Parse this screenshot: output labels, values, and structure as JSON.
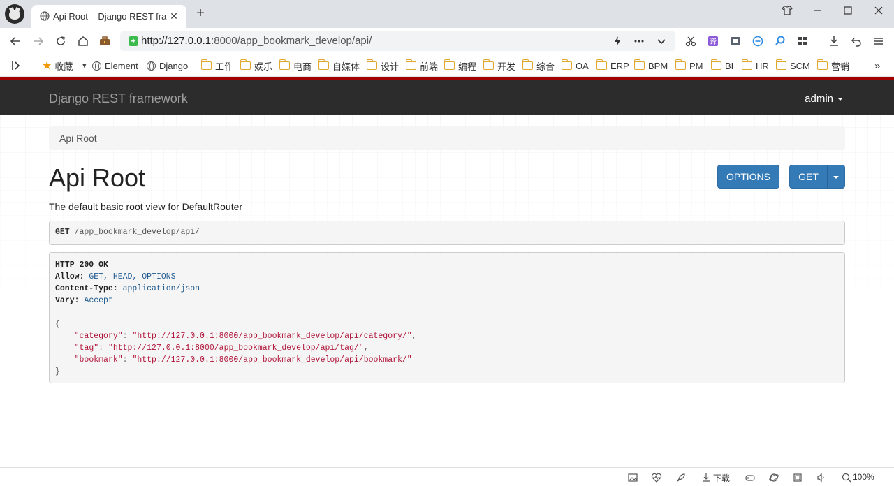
{
  "browser": {
    "tab_title": "Api Root – Django REST fra",
    "url_host": "http://127.0.0.1",
    "url_rest": ":8000/app_bookmark_develop/api/",
    "close_glyph": "✕",
    "newtab_glyph": "+",
    "zoom": "100%",
    "download_label": "下载",
    "bookmarks": [
      {
        "label": "收藏",
        "type": "star"
      },
      {
        "label": "Element",
        "type": "globe"
      },
      {
        "label": "Django",
        "type": "globe"
      },
      {
        "label": "工作",
        "type": "folder"
      },
      {
        "label": "娱乐",
        "type": "folder"
      },
      {
        "label": "电商",
        "type": "folder"
      },
      {
        "label": "自媒体",
        "type": "folder"
      },
      {
        "label": "设计",
        "type": "folder"
      },
      {
        "label": "前端",
        "type": "folder"
      },
      {
        "label": "编程",
        "type": "folder"
      },
      {
        "label": "开发",
        "type": "folder"
      },
      {
        "label": "综合",
        "type": "folder"
      },
      {
        "label": "OA",
        "type": "folder"
      },
      {
        "label": "ERP",
        "type": "folder"
      },
      {
        "label": "BPM",
        "type": "folder"
      },
      {
        "label": "PM",
        "type": "folder"
      },
      {
        "label": "BI",
        "type": "folder"
      },
      {
        "label": "HR",
        "type": "folder"
      },
      {
        "label": "SCM",
        "type": "folder"
      },
      {
        "label": "营销",
        "type": "folder"
      }
    ]
  },
  "app": {
    "brand": "Django REST framework",
    "user": "admin",
    "breadcrumb": "Api Root",
    "title": "Api Root",
    "options_label": "OPTIONS",
    "get_label": "GET",
    "description": "The default basic root view for DefaultRouter",
    "request_method": "GET",
    "request_path": "/app_bookmark_develop/api/",
    "response": {
      "status": "HTTP 200 OK",
      "headers": [
        {
          "key": "Allow:",
          "value": "GET, HEAD, OPTIONS"
        },
        {
          "key": "Content-Type:",
          "value": "application/json"
        },
        {
          "key": "Vary:",
          "value": "Accept"
        }
      ],
      "open_brace": "{",
      "close_brace": "}",
      "body": [
        {
          "key": "\"category\"",
          "value": "\"http://127.0.0.1:8000/app_bookmark_develop/api/category/\"",
          "comma": ","
        },
        {
          "key": "\"tag\"",
          "value": "\"http://127.0.0.1:8000/app_bookmark_develop/api/tag/\"",
          "comma": ","
        },
        {
          "key": "\"bookmark\"",
          "value": "\"http://127.0.0.1:8000/app_bookmark_develop/api/bookmark/\"",
          "comma": ""
        }
      ]
    }
  }
}
